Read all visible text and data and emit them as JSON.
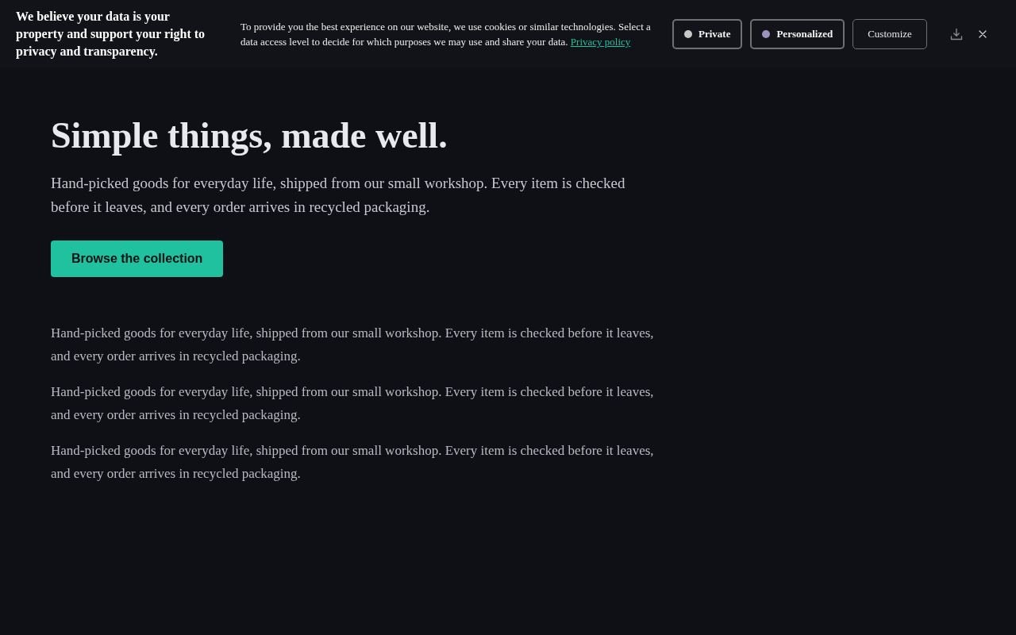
{
  "cookie_banner": {
    "heading": "We believe your data is your property and support your right to privacy and transparency.",
    "message": "To provide you the best experience on our website, we use cookies or similar technologies. Select a data access level to decide for which purposes we may use and share your data.",
    "privacy_link": "Privacy policy",
    "options": [
      {
        "label": "Private",
        "kind": "level",
        "color": "#c8c8c8"
      },
      {
        "label": "Personalized",
        "kind": "level",
        "color": "#9b93b8"
      },
      {
        "label": "Customize",
        "kind": "action"
      }
    ]
  },
  "hero": {
    "title": "Simple things, made well.",
    "lead": "Hand-picked goods for everyday life, shipped from our small workshop. Every item is checked before it leaves, and every order arrives in recycled packaging.",
    "cta": "Browse the collection"
  },
  "paragraphs": [
    "Hand-picked goods for everyday life, shipped from our small workshop. Every item is checked before it leaves, and every order arrives in recycled packaging.",
    "Hand-picked goods for everyday life, shipped from our small workshop. Every item is checked before it leaves, and every order arrives in recycled packaging.",
    "Hand-picked goods for everyday life, shipped from our small workshop. Every item is checked before it leaves, and every order arrives in recycled packaging."
  ]
}
